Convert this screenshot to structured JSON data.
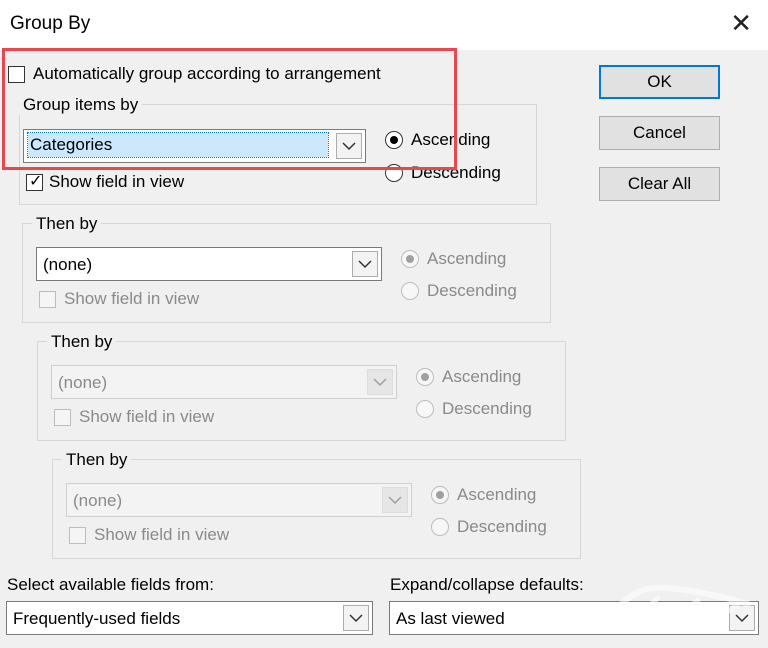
{
  "window": {
    "title": "Group By",
    "close_glyph": "✕"
  },
  "auto_group": {
    "label": "Automatically group according to arrangement",
    "checked": false
  },
  "group_items_by": {
    "title": "Group items by",
    "field": "Categories",
    "show_field_label": "Show field in view",
    "show_field_checked": true,
    "ascending_label": "Ascending",
    "descending_label": "Descending",
    "sort": "ascending"
  },
  "then_by": [
    {
      "title": "Then by",
      "field": "(none)",
      "show_field_label": "Show field in view",
      "ascending_label": "Ascending",
      "descending_label": "Descending"
    },
    {
      "title": "Then by",
      "field": "(none)",
      "show_field_label": "Show field in view",
      "ascending_label": "Ascending",
      "descending_label": "Descending"
    },
    {
      "title": "Then by",
      "field": "(none)",
      "show_field_label": "Show field in view",
      "ascending_label": "Ascending",
      "descending_label": "Descending"
    }
  ],
  "buttons": {
    "ok": "OK",
    "cancel": "Cancel",
    "clear_all": "Clear All"
  },
  "available_fields": {
    "label": "Select available fields from:",
    "value": "Frequently-used fields"
  },
  "expand_collapse": {
    "label": "Expand/collapse defaults:",
    "value": "As last viewed"
  },
  "colors": {
    "highlight": "#e8474f",
    "selection": "#cce8ff",
    "default_button_border": "#0078d7"
  }
}
